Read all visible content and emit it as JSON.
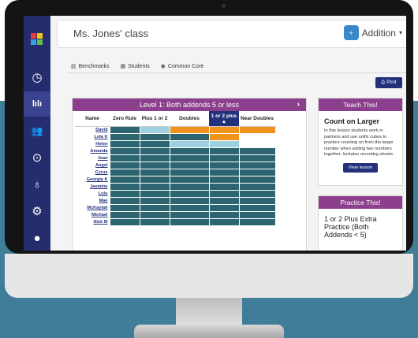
{
  "header": {
    "class_title": "Ms. Jones' class",
    "subject": "Addition",
    "subject_caret": "▾"
  },
  "tabs": [
    {
      "icon": "bar-chart-icon",
      "label": "Benchmarks"
    },
    {
      "icon": "grid-icon",
      "label": "Students"
    },
    {
      "icon": "target-icon",
      "label": "Common Core"
    }
  ],
  "print_label": "Print",
  "sidebar": {
    "items": [
      "logo",
      "clock-icon",
      "chart-icon",
      "users-icon",
      "play-icon",
      "award-icon",
      "gear-icon",
      "user-icon"
    ],
    "active_index": 2
  },
  "level": {
    "title": "Level 1: Both addends 5 or less",
    "next_arrow": "›"
  },
  "table": {
    "name_header": "Name",
    "columns": [
      "Zero Rule",
      "Plus 1 or 2",
      "Doubles",
      "1 or 2 plus",
      "Near Doubles"
    ],
    "sorted_column_index": 3,
    "sort_indicator": "▲",
    "rows": [
      {
        "name": "David",
        "cells": [
          "dark",
          "light",
          "orange",
          "orange",
          "orange"
        ]
      },
      {
        "name": "Lola K",
        "cells": [
          "dark",
          "dark",
          "dark",
          "orange",
          "none"
        ]
      },
      {
        "name": "Helen",
        "cells": [
          "dark",
          "dark",
          "light",
          "light",
          "none"
        ]
      },
      {
        "name": "Amanda",
        "cells": [
          "dark",
          "dark",
          "dark",
          "dark",
          "dark"
        ]
      },
      {
        "name": "Jean",
        "cells": [
          "dark",
          "dark",
          "dark",
          "dark",
          "dark"
        ]
      },
      {
        "name": "Angel",
        "cells": [
          "dark",
          "dark",
          "dark",
          "dark",
          "dark"
        ]
      },
      {
        "name": "Cyrus",
        "cells": [
          "dark",
          "dark",
          "dark",
          "dark",
          "dark"
        ]
      },
      {
        "name": "Georgia K",
        "cells": [
          "dark",
          "dark",
          "dark",
          "dark",
          "dark"
        ]
      },
      {
        "name": "Jasmine",
        "cells": [
          "dark",
          "dark",
          "dark",
          "dark",
          "dark"
        ]
      },
      {
        "name": "Lulu",
        "cells": [
          "dark",
          "dark",
          "dark",
          "dark",
          "dark"
        ]
      },
      {
        "name": "Mae",
        "cells": [
          "dark",
          "dark",
          "dark",
          "dark",
          "dark"
        ]
      },
      {
        "name": "McKaylah",
        "cells": [
          "dark",
          "dark",
          "dark",
          "dark",
          "dark"
        ]
      },
      {
        "name": "Michael",
        "cells": [
          "dark",
          "dark",
          "dark",
          "dark",
          "dark"
        ]
      },
      {
        "name": "Nick M",
        "cells": [
          "dark",
          "dark",
          "dark",
          "dark",
          "dark"
        ]
      }
    ]
  },
  "teach": {
    "header": "Teach This!",
    "title": "Count on Larger",
    "text": "In this lesson students work in partners and use unifix cubes to practice counting on from the larger number when adding two numbers together. Includes recording sheets.",
    "button": "View lesson"
  },
  "practice": {
    "header": "Practice This!",
    "title": "1 or 2 Plus Extra Practice (Both Addends < 5)"
  },
  "colors": {
    "purple": "#8b3f8d",
    "navy": "#23307a",
    "sidebar": "#252d6e",
    "orange": "#f0921b",
    "light_teal": "#9ed1dd",
    "dark_teal": "#2c6570",
    "wall_blue": "#3f7d99"
  }
}
